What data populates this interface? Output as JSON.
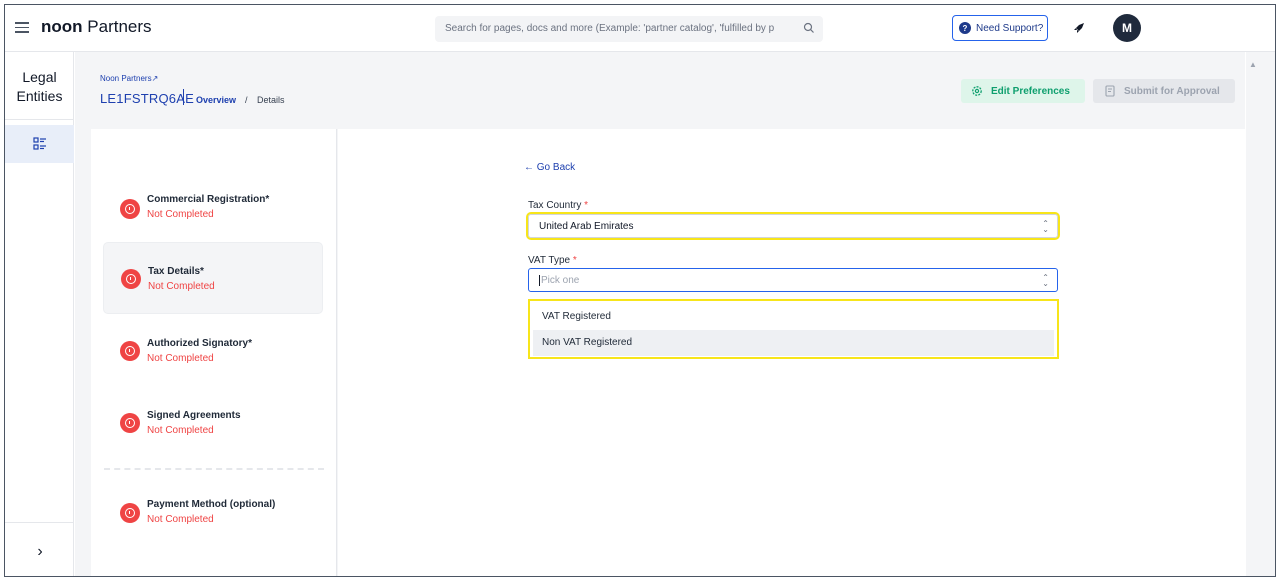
{
  "topbar": {
    "brand_bold": "noon",
    "brand_rest": " Partners",
    "search_placeholder": "Search for pages, docs and more (Example: 'partner catalog', 'fulfilled by p",
    "support_label": "Need Support?",
    "avatar_initial": "M"
  },
  "rail": {
    "title_line1": "Legal",
    "title_line2": "Entities",
    "expand_glyph": "›"
  },
  "header": {
    "parent_link": "Noon Partners",
    "external_glyph": "↗",
    "entity_id": "LE1FSTRQ6AE",
    "breadcrumb_overview": "Overview",
    "breadcrumb_separator": "/",
    "breadcrumb_current": "Details",
    "edit_label": "Edit Preferences",
    "submit_label": "Submit for Approval"
  },
  "steps": [
    {
      "title": "Commercial Registration*",
      "status": "Not Completed"
    },
    {
      "title": "Tax Details*",
      "status": "Not Completed"
    },
    {
      "title": "Authorized Signatory*",
      "status": "Not Completed"
    },
    {
      "title": "Signed Agreements",
      "status": "Not Completed"
    },
    {
      "title": "Payment Method (optional)",
      "status": "Not Completed"
    }
  ],
  "form": {
    "go_back": "← Go Back",
    "tax_country_label": "Tax Country",
    "required_mark": "*",
    "tax_country_value": "United Arab Emirates",
    "vat_type_label": "VAT Type",
    "vat_type_placeholder": "Pick one",
    "vat_options": [
      "VAT Registered",
      "Non VAT Registered"
    ]
  },
  "colors": {
    "primary": "#1e40af",
    "success": "#0e9f6e",
    "error": "#ef4444",
    "highlight": "#f7e51a"
  }
}
